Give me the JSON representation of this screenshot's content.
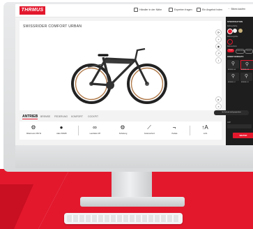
{
  "colors": {
    "brand_red": "#e3182d",
    "panel_dark": "#1e1e1e",
    "screen_bg": "#f3f3f3"
  },
  "header": {
    "logo": "THRMUS",
    "links": [
      {
        "label": "Händler in der Nähe",
        "icon": "pin-icon"
      },
      {
        "label": "Experten fragen",
        "icon": "chat-icon"
      },
      {
        "label": "Ein Angebot holen",
        "icon": "mail-icon"
      },
      {
        "label": "Bikes kaufen",
        "icon": "more-icon"
      }
    ]
  },
  "main": {
    "title": "SWISSRIDER COMFORT URBAN"
  },
  "tabs": [
    {
      "label": "ANTRIEB",
      "active": true
    },
    {
      "label": "BREMSE"
    },
    {
      "label": "FEDERUNG"
    },
    {
      "label": "KOMFORT"
    },
    {
      "label": "COCKPIT"
    }
  ],
  "components": [
    {
      "label": "Mittelmotor 250 W",
      "icon": "motor-icon"
    },
    {
      "label": "Akku 500Wh",
      "icon": "battery-icon"
    },
    {
      "label": "Laufräder 28\"",
      "icon": "wheel-icon"
    },
    {
      "label": "Schaltung",
      "icon": "gear-icon"
    },
    {
      "label": "Kettenschutz",
      "icon": "chain-icon"
    },
    {
      "label": "Pedale",
      "icon": "pedal-icon"
    },
    {
      "label": "Licht",
      "icon": "light-icon"
    }
  ],
  "panel": {
    "section1": "SPEZIFIKATION",
    "frame_color_label": "Rahmenfarbe",
    "frame_sub_label": "Rahmengröße",
    "frame_type_label": "Rahmenform",
    "frame_types": [
      "Trapez",
      "Tiefeinstieg",
      "Herren"
    ],
    "section2": "HOBBY/EINSATZ",
    "variants": [
      {
        "label": "MODELL A"
      },
      {
        "label": "MODELL B"
      },
      {
        "label": "MODELL C"
      },
      {
        "label": "MODELL D"
      }
    ],
    "tooltip": "Ihr Fahrrad wird gespeichert",
    "price_label": "UVP",
    "weiter": "WEITER"
  }
}
